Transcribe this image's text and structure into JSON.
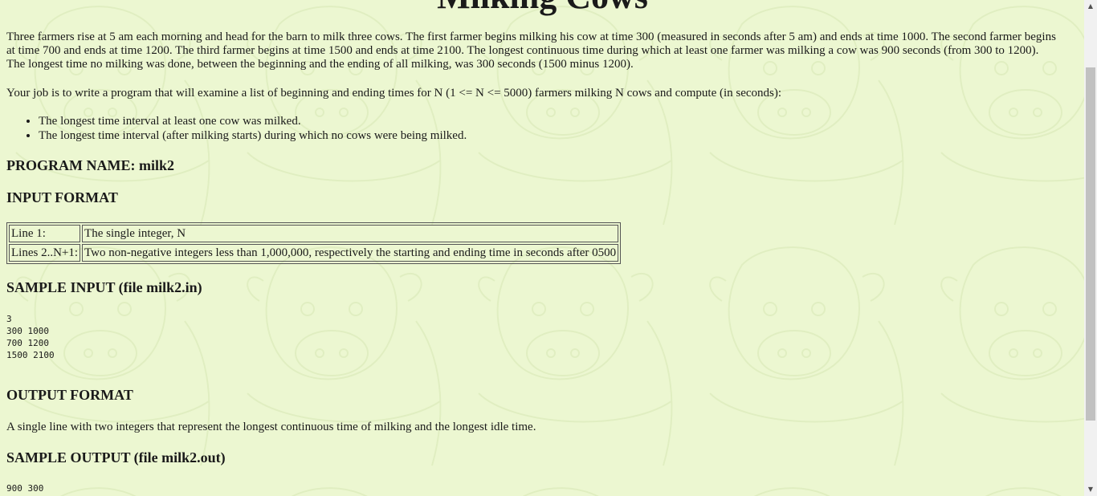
{
  "problem": {
    "title": "Milking Cows",
    "intro": "Three farmers rise at 5 am each morning and head for the barn to milk three cows. The first farmer begins milking his cow at time 300 (measured in seconds after 5 am) and ends at time 1000. The second farmer begins at time 700 and ends at time 1200. The third farmer begins at time 1500 and ends at time 2100. The longest continuous time during which at least one farmer was milking a cow was 900 seconds (from 300 to 1200). The longest time no milking was done, between the beginning and the ending of all milking, was 300 seconds (1500 minus 1200).",
    "task": "Your job is to write a program that will examine a list of beginning and ending times for N (1 <= N <= 5000) farmers milking N cows and compute (in seconds):",
    "bullets": [
      "The longest time interval at least one cow was milked.",
      "The longest time interval (after milking starts) during which no cows were being milked."
    ]
  },
  "sections": {
    "program_name": "PROGRAM NAME: milk2",
    "input_format": "INPUT FORMAT",
    "sample_input": "SAMPLE INPUT (file milk2.in)",
    "output_format": "OUTPUT FORMAT",
    "sample_output": "SAMPLE OUTPUT (file milk2.out)"
  },
  "input_table": {
    "rows": [
      {
        "line": "Line 1:",
        "desc": "The single integer, N"
      },
      {
        "line": "Lines 2..N+1:",
        "desc": "Two non-negative integers less than 1,000,000, respectively the starting and ending time in seconds after 0500"
      }
    ]
  },
  "sample_input_lines": "3\n300 1000\n700 1200\n1500 2100",
  "output_text": "A single line with two integers that represent the longest continuous time of milking and the longest idle time.",
  "sample_output_lines": "900 300",
  "scrollbar": {
    "up_icon": "triangle-up",
    "down_icon": "triangle-down"
  }
}
